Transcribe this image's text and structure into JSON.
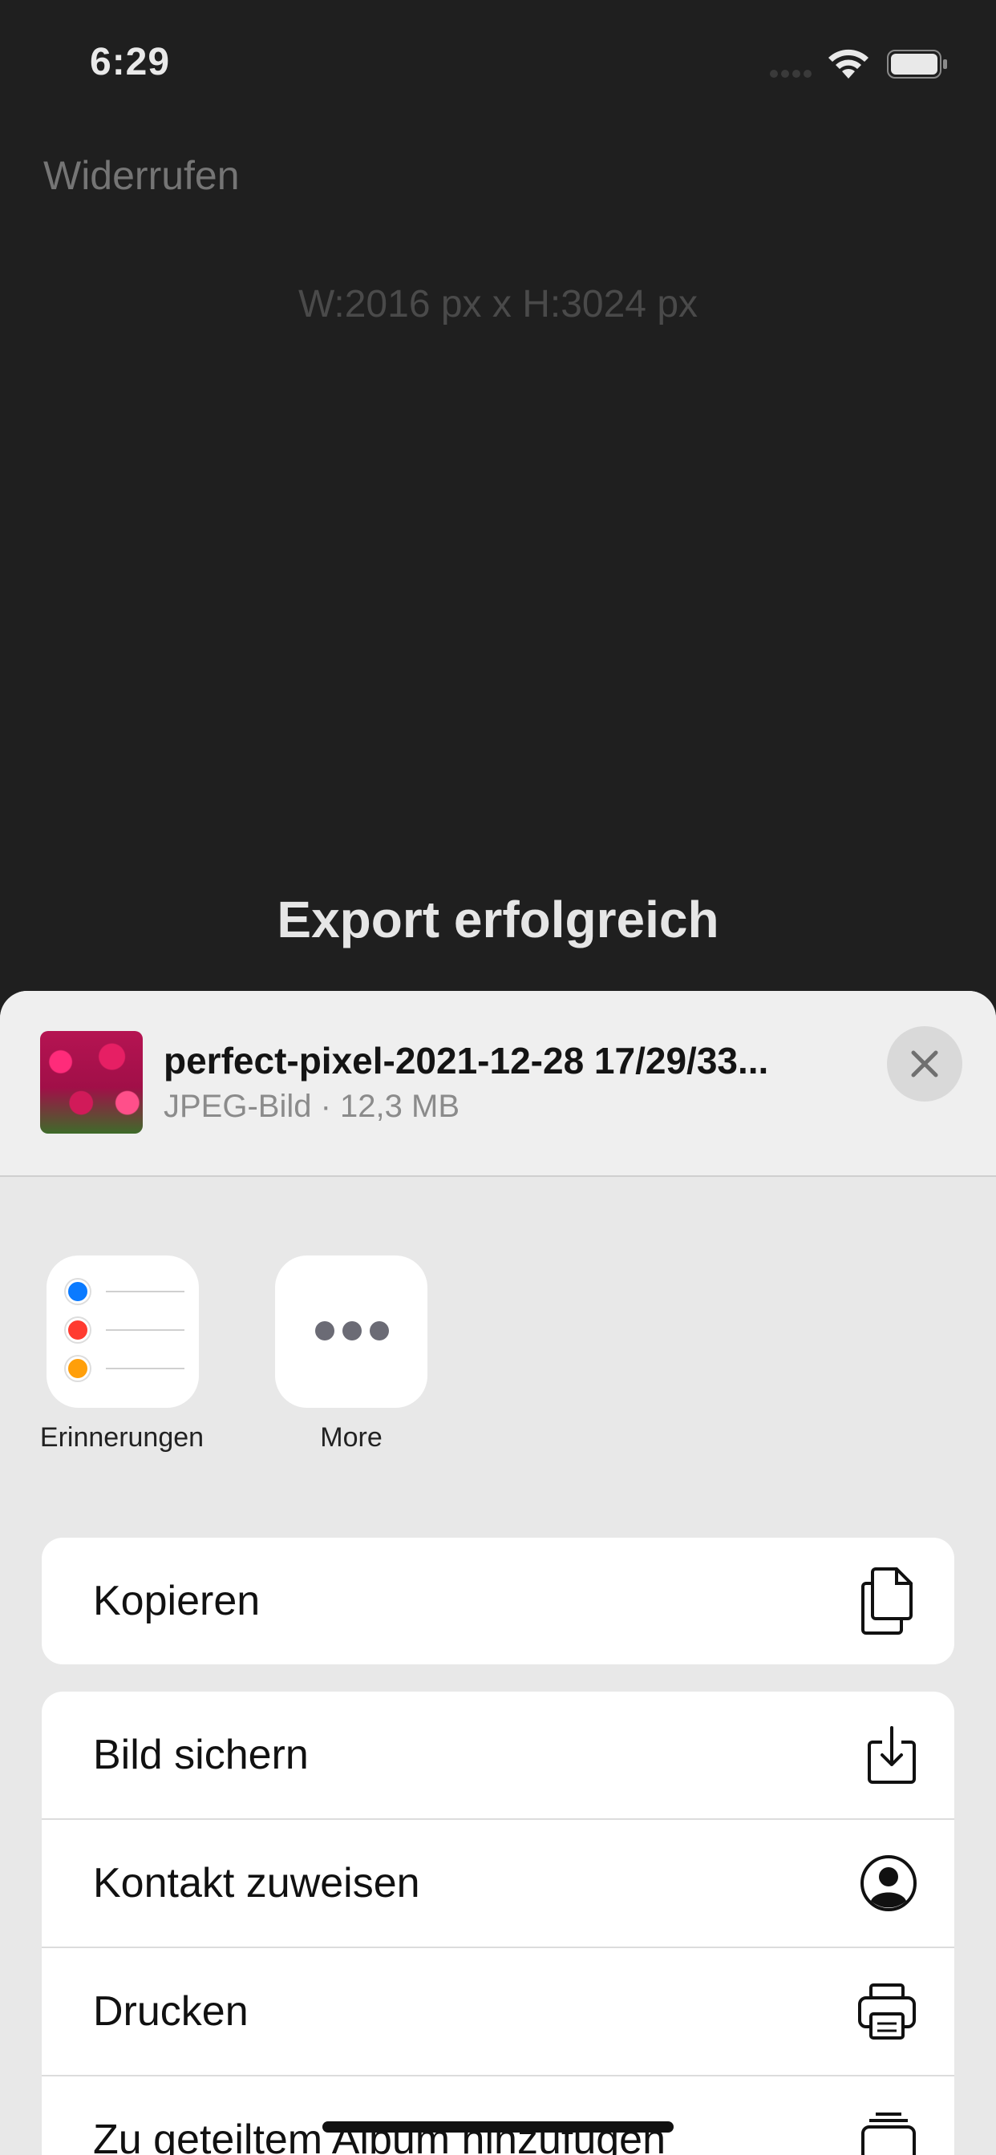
{
  "status_bar": {
    "time": "6:29"
  },
  "editor": {
    "undo_label": "Widerrufen",
    "dimensions": "W:2016 px x H:3024 px",
    "export_message": "Export erfolgreich"
  },
  "share_sheet": {
    "file": {
      "title": "perfect-pixel-2021-12-28 17/29/33...",
      "subtitle": "JPEG-Bild · 12,3 MB"
    },
    "apps": [
      {
        "label": "Erinnerungen",
        "icon": "reminders-app-icon"
      },
      {
        "label": "More",
        "icon": "more-icon"
      }
    ],
    "actions_group1": [
      {
        "label": "Kopieren",
        "icon": "copy-icon"
      }
    ],
    "actions_group2": [
      {
        "label": "Bild sichern",
        "icon": "download-icon"
      },
      {
        "label": "Kontakt zuweisen",
        "icon": "contact-icon"
      },
      {
        "label": "Drucken",
        "icon": "printer-icon"
      },
      {
        "label": "Zu geteiltem Album hinzufügen",
        "icon": "shared-album-icon"
      }
    ]
  },
  "colors": {
    "background": "#1f1f1f",
    "sheet": "#e8e8e8",
    "reminder_dots": [
      "#0a7aff",
      "#ff3b30",
      "#ff9f0a"
    ]
  }
}
